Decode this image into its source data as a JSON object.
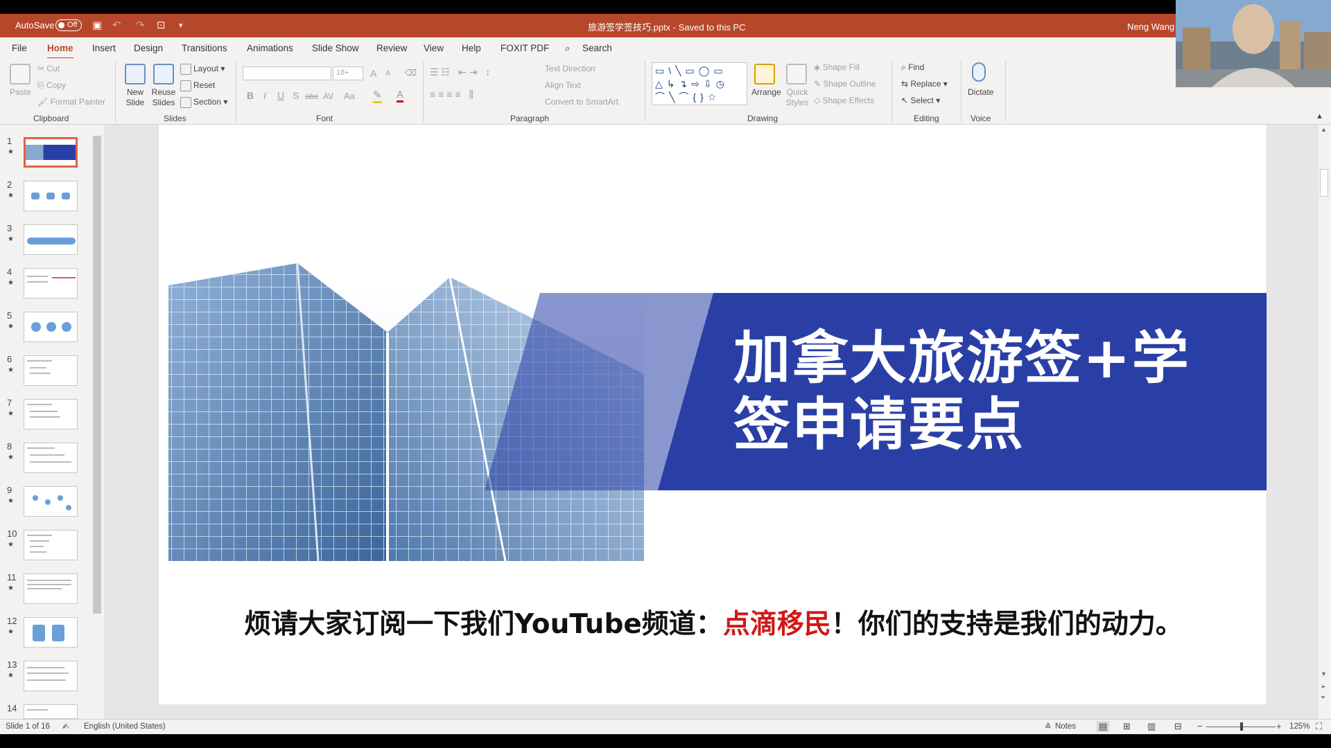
{
  "titlebar": {
    "autosave_label": "AutoSave",
    "autosave_state": "Off",
    "document": "旅游签学签技巧.pptx  -  Saved to this PC",
    "user": "Neng Wang"
  },
  "menu": [
    "File",
    "Home",
    "Insert",
    "Design",
    "Transitions",
    "Animations",
    "Slide Show",
    "Review",
    "View",
    "Help",
    "FOXIT PDF"
  ],
  "search_label": "Search",
  "ribbon": {
    "clipboard": {
      "paste": "Paste",
      "cut": "Cut",
      "copy": "Copy",
      "format_painter": "Format Painter",
      "label": "Clipboard"
    },
    "slides": {
      "new_slide": "New Slide",
      "reuse_slides": "Reuse Slides",
      "layout": "Layout",
      "reset": "Reset",
      "section": "Section",
      "label": "Slides"
    },
    "font": {
      "size": "18+",
      "bold": "B",
      "italic": "I",
      "underline": "U",
      "shadow": "S",
      "strike": "abc",
      "spacing": "AV",
      "case": "Aa",
      "grow": "A",
      "shrink": "A",
      "label": "Font"
    },
    "paragraph": {
      "text_direction": "Text Direction",
      "align_text": "Align Text",
      "convert_smartart": "Convert to SmartArt",
      "label": "Paragraph"
    },
    "drawing": {
      "arrange": "Arrange",
      "quick_styles": "Quick Styles",
      "shape_fill": "Shape Fill",
      "shape_outline": "Shape Outline",
      "shape_effects": "Shape Effects",
      "label": "Drawing"
    },
    "editing": {
      "find": "Find",
      "replace": "Replace",
      "select": "Select",
      "label": "Editing"
    },
    "voice": {
      "dictate": "Dictate",
      "label": "Voice"
    }
  },
  "thumbnails": [
    "1",
    "2",
    "3",
    "4",
    "5",
    "6",
    "7",
    "8",
    "9",
    "10",
    "11",
    "12",
    "13",
    "14"
  ],
  "slide": {
    "title_line1": "加拿大旅游签+学",
    "title_line2": "签申请要点",
    "subtitle_pre": "烦请大家订阅一下我们YouTube频道：",
    "subtitle_highlight": "点滴移民",
    "subtitle_post": "！你们的支持是我们的动力。"
  },
  "status": {
    "slide_counter": "Slide 1 of 16",
    "language": "English (United States)",
    "notes": "Notes",
    "zoom": "125%"
  },
  "colors": {
    "accent": "#b7472a",
    "slide_blue": "#2a3fa6",
    "highlight_red": "#d01818"
  }
}
